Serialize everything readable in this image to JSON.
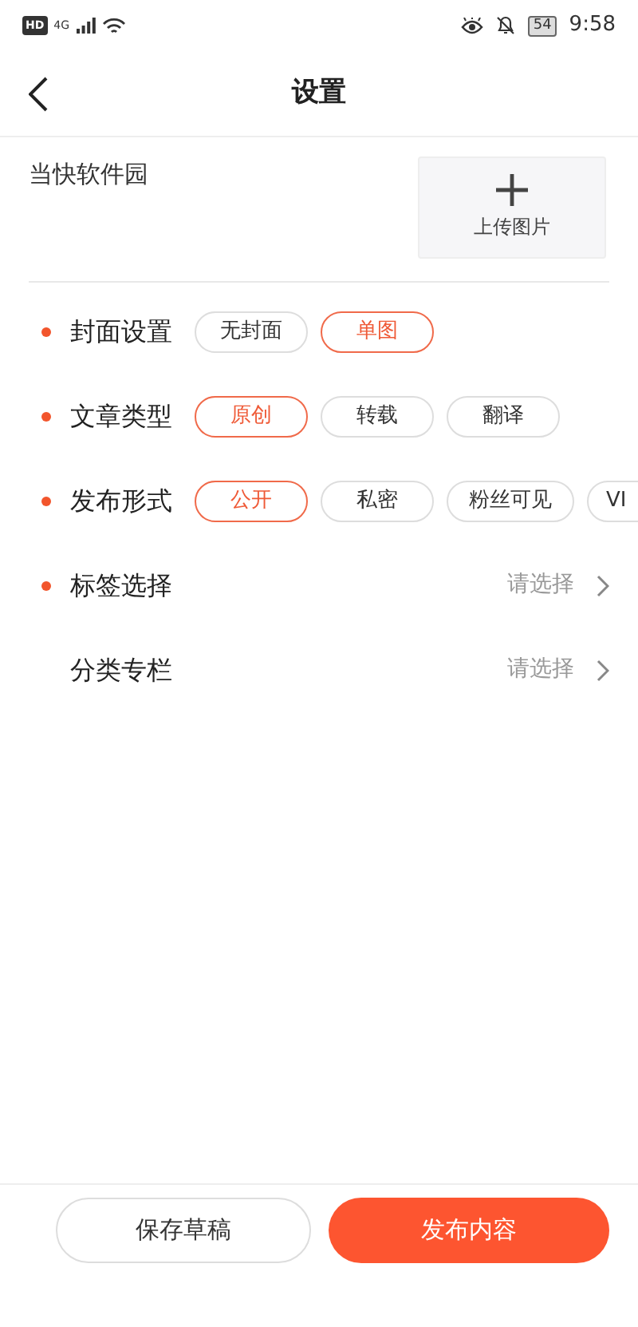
{
  "status_bar": {
    "network": "HD",
    "signal": "4G",
    "battery": "54",
    "time": "9:58"
  },
  "header": {
    "title": "设置"
  },
  "article": {
    "title": "当快软件园",
    "upload_label": "上传图片"
  },
  "settings": [
    {
      "label": "封面设置",
      "required": true,
      "kind": "options",
      "options": [
        {
          "label": "无封面",
          "selected": false
        },
        {
          "label": "单图",
          "selected": true
        }
      ]
    },
    {
      "label": "文章类型",
      "required": true,
      "kind": "options",
      "options": [
        {
          "label": "原创",
          "selected": true
        },
        {
          "label": "转载",
          "selected": false
        },
        {
          "label": "翻译",
          "selected": false
        }
      ]
    },
    {
      "label": "发布形式",
      "required": true,
      "kind": "options",
      "options": [
        {
          "label": "公开",
          "selected": true
        },
        {
          "label": "私密",
          "selected": false
        },
        {
          "label": "粉丝可见",
          "selected": false
        },
        {
          "label": "VI",
          "selected": false
        }
      ]
    },
    {
      "label": "标签选择",
      "required": true,
      "kind": "picker",
      "value": "请选择"
    },
    {
      "label": "分类专栏",
      "required": false,
      "kind": "picker",
      "value": "请选择"
    }
  ],
  "footer": {
    "buttons": [
      {
        "label": "保存草稿",
        "kind": "secondary"
      },
      {
        "label": "发布内容",
        "kind": "primary"
      }
    ]
  }
}
